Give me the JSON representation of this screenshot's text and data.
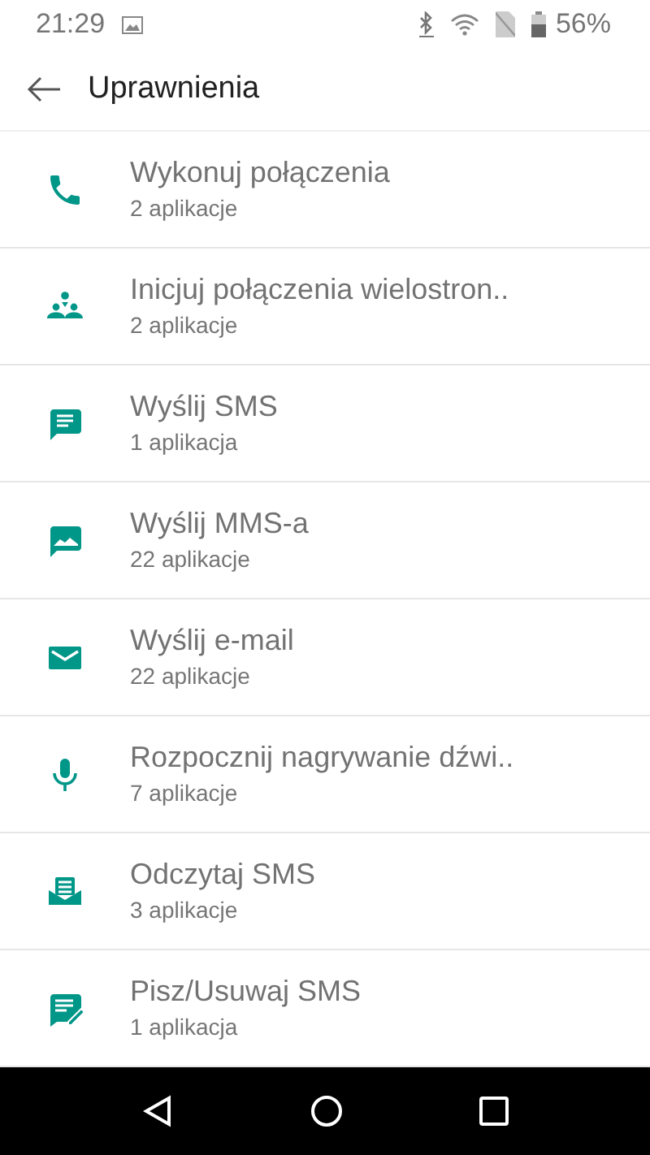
{
  "status_bar": {
    "time": "21:29",
    "battery": "56%"
  },
  "app_bar": {
    "title": "Uprawnienia"
  },
  "permissions": [
    {
      "kind": "phone",
      "title": "Wykonuj połączenia",
      "subtitle": "2 aplikacje"
    },
    {
      "kind": "conference",
      "title": "Inicjuj połączenia wielostron..",
      "subtitle": "2 aplikacje"
    },
    {
      "kind": "sms",
      "title": "Wyślij SMS",
      "subtitle": "1 aplikacja"
    },
    {
      "kind": "mms",
      "title": "Wyślij MMS-a",
      "subtitle": "22 aplikacje"
    },
    {
      "kind": "email",
      "title": "Wyślij e-mail",
      "subtitle": "22 aplikacje"
    },
    {
      "kind": "mic",
      "title": "Rozpocznij nagrywanie dźwi..",
      "subtitle": "7 aplikacje"
    },
    {
      "kind": "read-sms",
      "title": "Odczytaj SMS",
      "subtitle": "3 aplikacje"
    },
    {
      "kind": "write-sms",
      "title": "Pisz/Usuwaj SMS",
      "subtitle": "1 aplikacja"
    }
  ]
}
